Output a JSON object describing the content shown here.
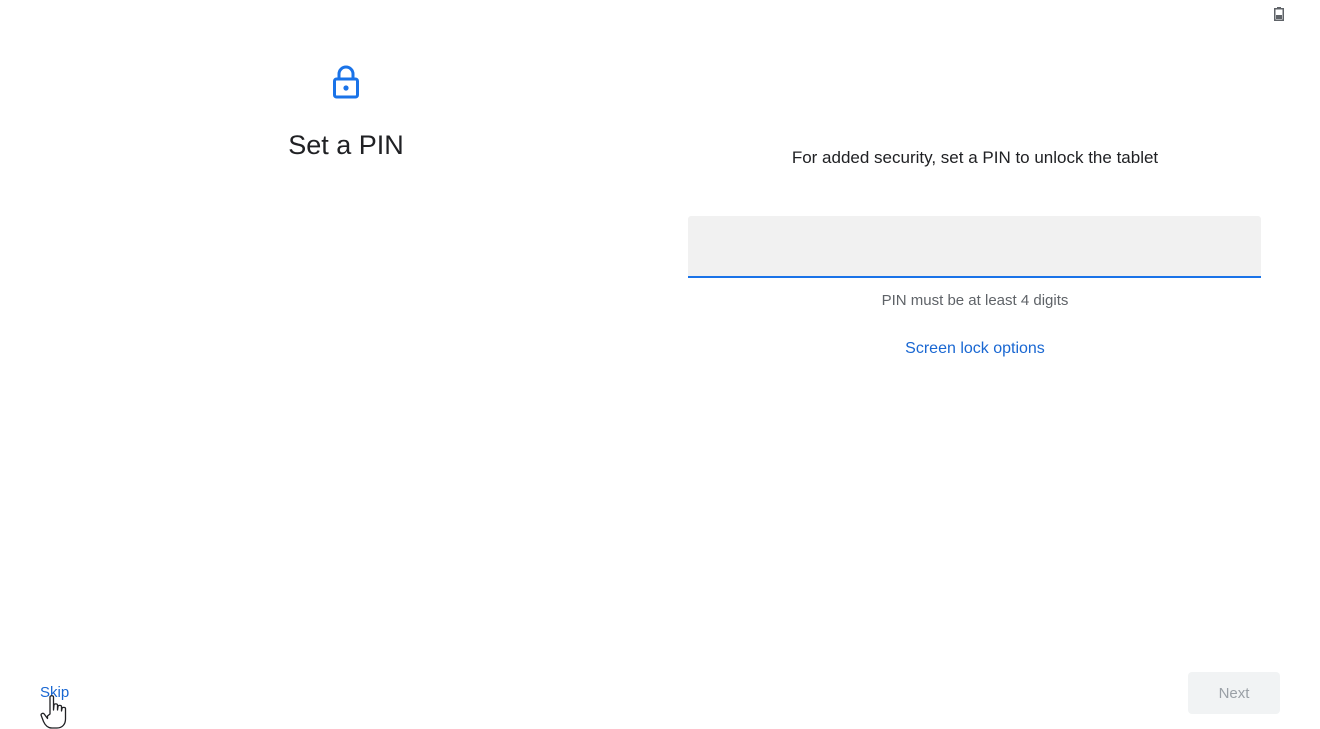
{
  "status_bar": {
    "battery_icon": "battery-icon"
  },
  "header": {
    "icon": "lock-icon",
    "title": "Set a PIN"
  },
  "main": {
    "description": "For added security, set a PIN to unlock the tablet",
    "pin_input": {
      "value": "",
      "placeholder": ""
    },
    "hint": "PIN must be at least 4 digits",
    "screen_lock_options_label": "Screen lock options"
  },
  "footer": {
    "skip_label": "Skip",
    "next_label": "Next",
    "next_enabled": false
  },
  "colors": {
    "accent": "#1a73e8",
    "link": "#1967d2",
    "disabled_text": "#9aa0a6"
  }
}
